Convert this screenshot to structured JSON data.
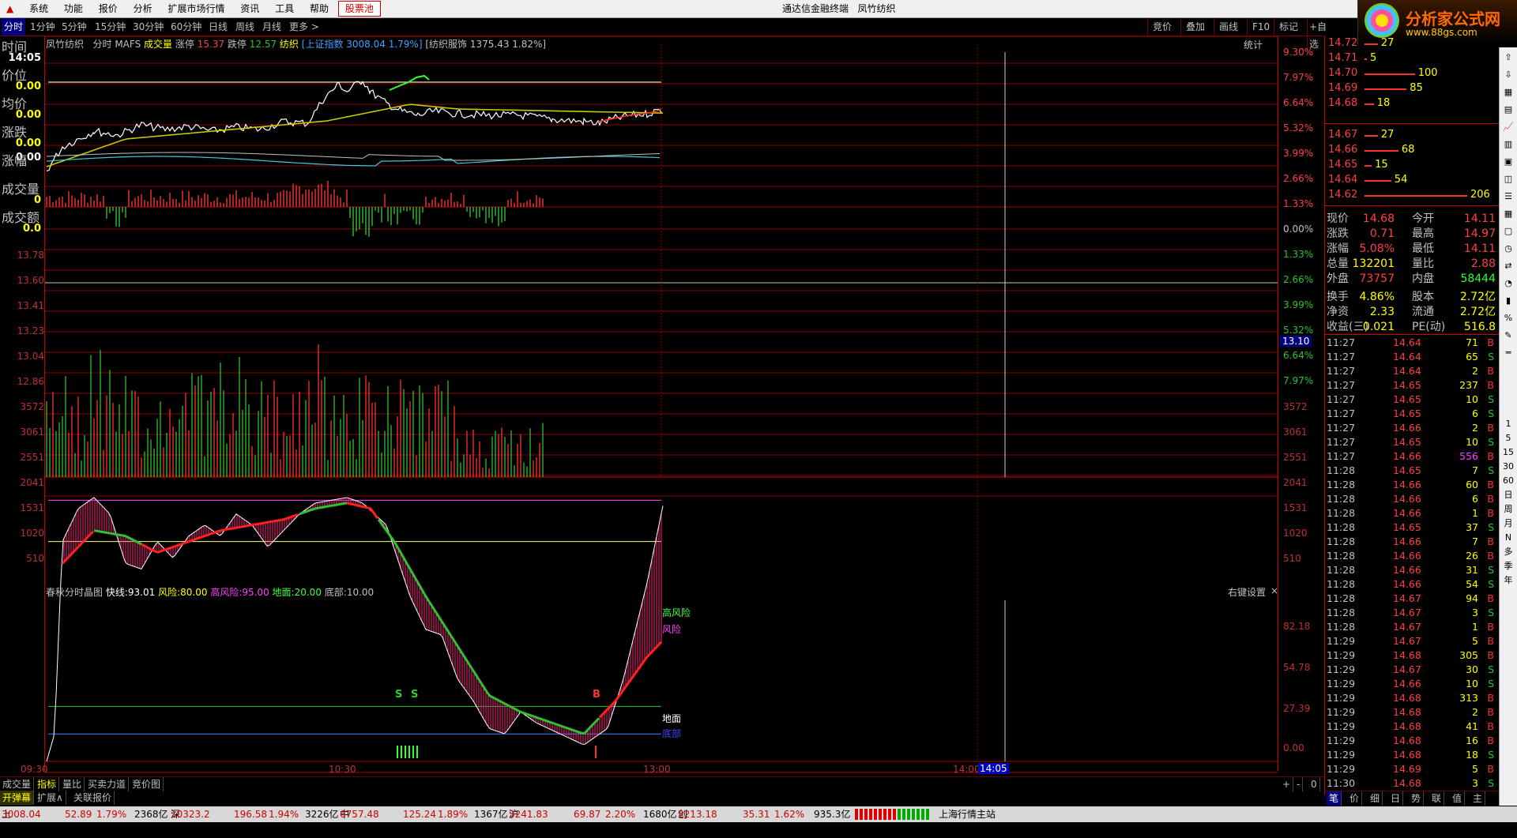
{
  "menu": [
    "系统",
    "功能",
    "报价",
    "分析",
    "扩展市场行情",
    "资讯",
    "工具",
    "帮助"
  ],
  "menu_highlight": "股票池",
  "app_title": "通达信金融终端",
  "stock_name_title": "凤竹纺织",
  "logo": {
    "name": "分析家公式网",
    "url": "www.88gs.com"
  },
  "period_tabs": [
    "分时",
    "1分钟",
    "5分钟",
    "15分钟",
    "30分钟",
    "60分钟",
    "日线",
    "周线",
    "月线",
    "更多"
  ],
  "right_tools": [
    "竞价",
    "叠加",
    "画线",
    "F10",
    "标记",
    "+自选"
  ],
  "left_labels": {
    "time": "时间",
    "time_val": "14:05",
    "price": "价位",
    "price_val": "0.00",
    "avg": "均价",
    "avg_val": "0.00",
    "chg": "涨跌",
    "chg_val": "0.00",
    "chg_val2": "0.00",
    "pct": "涨幅",
    "vol": "成交量",
    "vol_val": "0",
    "amt": "成交额",
    "amt_val": "0.0"
  },
  "chart_info": {
    "stock": "凤竹纺织",
    "mode": "分时",
    "mafs": "MAFS",
    "vol": "成交量",
    "up_label": "涨停",
    "up_val": "15.37",
    "dn_label": "跌停",
    "dn_val": "12.57",
    "sector": "纺织",
    "index": "[上证指数 3008.04 1.79%]",
    "sector_index": "[纺织服饰 1375.43 1.82%]",
    "stat": "统计"
  },
  "price_axis_left": [
    "13.78",
    "13.60",
    "13.41",
    "13.23",
    "13.04",
    "12.86"
  ],
  "pct_axis_right": [
    "9.30%",
    "7.97%",
    "6.64%",
    "5.32%",
    "3.99%",
    "2.66%",
    "1.33%",
    "0.00%",
    "1.33%",
    "2.66%",
    "3.99%",
    "5.32%",
    "6.64%",
    "7.97%"
  ],
  "crosshair_price": "13.10",
  "vol_axis": [
    "3572",
    "3061",
    "2551",
    "2041",
    "1531",
    "1020",
    "510"
  ],
  "indicator": {
    "title": "春秋分时晶图",
    "fast_label": "快线:",
    "fast": "93.01",
    "risk_label": "风险:",
    "risk": "80.00",
    "high_risk_label": "高风险:",
    "high_risk": "95.00",
    "ground_label": "地面:",
    "ground": "20.00",
    "bottom_label": "底部:",
    "bottom": "10.00",
    "settings": "右键设置",
    "lbl_high": "高风险",
    "lbl_risk": "风险",
    "lbl_ground": "地面",
    "lbl_bottom": "底部",
    "sig_s1": "S",
    "sig_s2": "S",
    "sig_b": "B"
  },
  "ind_axis": [
    "82.18",
    "54.78",
    "27.39",
    "0.00"
  ],
  "time_axis": [
    "09:30",
    "10:30",
    "13:00",
    "14:00"
  ],
  "time_cursor": "14:05",
  "order_book": {
    "asks": [
      {
        "p": "14.72",
        "v": "27",
        "w": 0.13
      },
      {
        "p": "14.71",
        "v": "5",
        "w": 0.02
      },
      {
        "p": "14.70",
        "v": "100",
        "w": 0.49
      },
      {
        "p": "14.69",
        "v": "85",
        "w": 0.41
      },
      {
        "p": "14.68",
        "v": "18",
        "w": 0.09
      }
    ],
    "bids": [
      {
        "p": "14.67",
        "v": "27",
        "w": 0.13
      },
      {
        "p": "14.66",
        "v": "68",
        "w": 0.33
      },
      {
        "p": "14.65",
        "v": "15",
        "w": 0.07
      },
      {
        "p": "14.64",
        "v": "54",
        "w": 0.26
      },
      {
        "p": "14.62",
        "v": "206",
        "w": 1.0
      }
    ]
  },
  "stats": [
    {
      "k1": "现价",
      "v1": "14.68",
      "c1": "#ff4040",
      "k2": "今开",
      "v2": "14.11",
      "c2": "#ff4040"
    },
    {
      "k1": "涨跌",
      "v1": "0.71",
      "c1": "#ff4040",
      "k2": "最高",
      "v2": "14.97",
      "c2": "#ff4040"
    },
    {
      "k1": "涨幅",
      "v1": "5.08%",
      "c1": "#ff4040",
      "k2": "最低",
      "v2": "14.11",
      "c2": "#ff4040"
    },
    {
      "k1": "总量",
      "v1": "132201",
      "c1": "#ffff00",
      "k2": "量比",
      "v2": "2.88",
      "c2": "#ff4040"
    },
    {
      "k1": "外盘",
      "v1": "73757",
      "c1": "#ff4040",
      "k2": "内盘",
      "v2": "58444",
      "c2": "#30ff30"
    },
    {
      "k1": "换手",
      "v1": "4.86%",
      "c1": "#ffff00",
      "k2": "股本",
      "v2": "2.72亿",
      "c2": "#ffff00"
    },
    {
      "k1": "净资",
      "v1": "2.33",
      "c1": "#ffff00",
      "k2": "流通",
      "v2": "2.72亿",
      "c2": "#ffff00"
    },
    {
      "k1": "收益(三)",
      "v1": "0.021",
      "c1": "#ffff00",
      "k2": "PE(动)",
      "v2": "516.8",
      "c2": "#ffff00"
    }
  ],
  "ticks": [
    {
      "t": "11:27",
      "p": "14.64",
      "v": "71",
      "d": "B"
    },
    {
      "t": "11:27",
      "p": "14.64",
      "v": "65",
      "d": "S"
    },
    {
      "t": "11:27",
      "p": "14.64",
      "v": "2",
      "d": "B"
    },
    {
      "t": "11:27",
      "p": "14.65",
      "v": "237",
      "d": "B"
    },
    {
      "t": "11:27",
      "p": "14.65",
      "v": "10",
      "d": "S"
    },
    {
      "t": "11:27",
      "p": "14.65",
      "v": "6",
      "d": "S"
    },
    {
      "t": "11:27",
      "p": "14.66",
      "v": "2",
      "d": "B"
    },
    {
      "t": "11:27",
      "p": "14.65",
      "v": "10",
      "d": "S"
    },
    {
      "t": "11:27",
      "p": "14.66",
      "v": "556",
      "d": "B"
    },
    {
      "t": "11:28",
      "p": "14.65",
      "v": "7",
      "d": "S"
    },
    {
      "t": "11:28",
      "p": "14.66",
      "v": "60",
      "d": "B"
    },
    {
      "t": "11:28",
      "p": "14.66",
      "v": "6",
      "d": "B"
    },
    {
      "t": "11:28",
      "p": "14.66",
      "v": "1",
      "d": "B"
    },
    {
      "t": "11:28",
      "p": "14.65",
      "v": "37",
      "d": "S"
    },
    {
      "t": "11:28",
      "p": "14.66",
      "v": "7",
      "d": "B"
    },
    {
      "t": "11:28",
      "p": "14.66",
      "v": "26",
      "d": "B"
    },
    {
      "t": "11:28",
      "p": "14.66",
      "v": "31",
      "d": "S"
    },
    {
      "t": "11:28",
      "p": "14.66",
      "v": "54",
      "d": "S"
    },
    {
      "t": "11:28",
      "p": "14.67",
      "v": "94",
      "d": "B"
    },
    {
      "t": "11:28",
      "p": "14.67",
      "v": "3",
      "d": "S"
    },
    {
      "t": "11:28",
      "p": "14.67",
      "v": "1",
      "d": "B"
    },
    {
      "t": "11:29",
      "p": "14.67",
      "v": "5",
      "d": "B"
    },
    {
      "t": "11:29",
      "p": "14.68",
      "v": "305",
      "d": "B"
    },
    {
      "t": "11:29",
      "p": "14.67",
      "v": "30",
      "d": "S"
    },
    {
      "t": "11:29",
      "p": "14.66",
      "v": "10",
      "d": "S"
    },
    {
      "t": "11:29",
      "p": "14.68",
      "v": "313",
      "d": "B"
    },
    {
      "t": "11:29",
      "p": "14.68",
      "v": "2",
      "d": "B"
    },
    {
      "t": "11:29",
      "p": "14.68",
      "v": "41",
      "d": "B"
    },
    {
      "t": "11:29",
      "p": "14.68",
      "v": "16",
      "d": "B"
    },
    {
      "t": "11:29",
      "p": "14.68",
      "v": "18",
      "d": "S"
    },
    {
      "t": "11:29",
      "p": "14.69",
      "v": "5",
      "d": "B"
    },
    {
      "t": "11:30",
      "p": "14.68",
      "v": "3",
      "d": "S"
    }
  ],
  "rp_bottom_tabs": [
    "笔",
    "价",
    "细",
    "日",
    "势",
    "联",
    "值",
    "主"
  ],
  "side_tools": [
    "1",
    "5",
    "15",
    "30",
    "60",
    "日",
    "周",
    "月",
    "N",
    "多",
    "季",
    "年"
  ],
  "bottom_tabs": [
    "成交量",
    "指标",
    "量比",
    "买卖力道",
    "竞价图"
  ],
  "bottom_tabs2": [
    "开弹幕",
    "扩展∧",
    "关联报价"
  ],
  "bottom_ctrl": [
    "+",
    "-",
    "0"
  ],
  "status": {
    "sh_label": "上证",
    "sh": "3008.04",
    "sh_chg": "52.89",
    "sh_pct": "1.79%",
    "sh_amt": "2368亿",
    "sz_label": "深证",
    "sz": "10323.2",
    "sz_chg": "196.58",
    "sz_pct": "1.94%",
    "sz_amt": "3226亿",
    "zx_label": "中小",
    "zx": "6757.48",
    "zx_chg": "125.24",
    "zx_pct": "1.89%",
    "zx_amt": "1367亿",
    "hs_label": "沪深",
    "hs": "3241.83",
    "hs_chg": "69.87",
    "hs_pct": "2.20%",
    "hs_amt": "1680亿",
    "cy_label": "创业",
    "cy": "2213.18",
    "cy_chg": "35.31",
    "cy_pct": "1.62%",
    "cy_amt": "935.3亿",
    "server": "上海行情主站"
  },
  "colors": {
    "up": "#ff4040",
    "down": "#30c030",
    "grid": "#8b0000",
    "price_line": "#ffffff",
    "avg_line": "#c8c800"
  }
}
